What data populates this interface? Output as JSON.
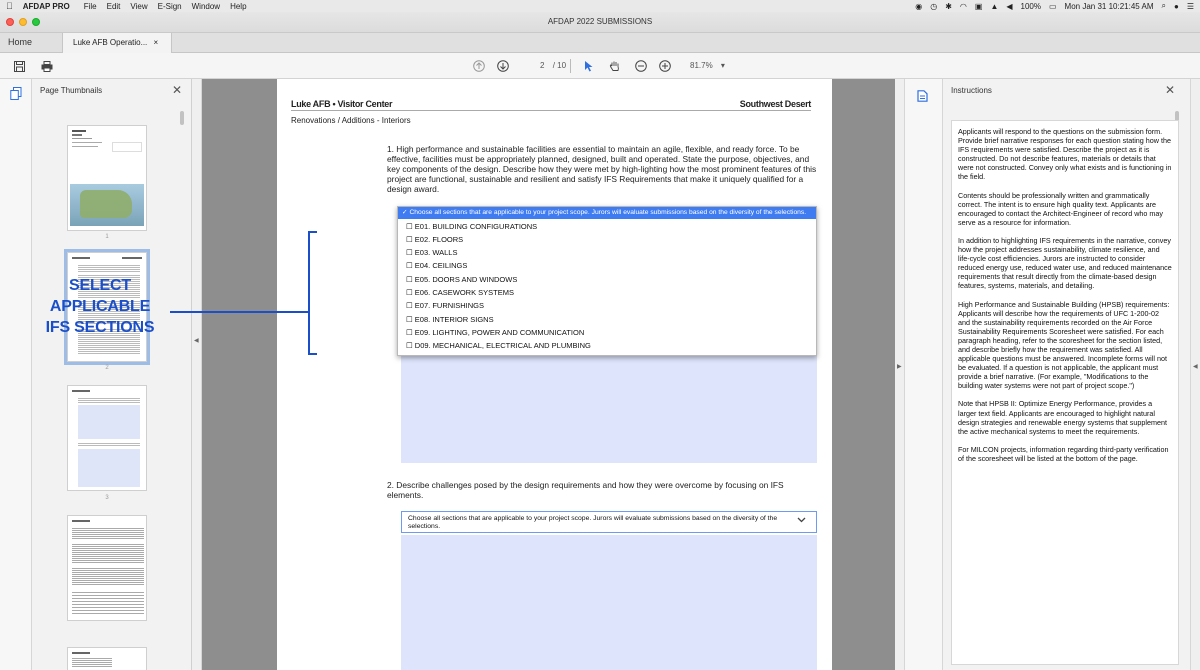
{
  "menubar": {
    "app_name": "AFDAP PRO",
    "items": [
      "File",
      "Edit",
      "View",
      "E-Sign",
      "Window",
      "Help"
    ],
    "battery": "100%",
    "datetime": "Mon Jan 31  10:21:45 AM"
  },
  "window": {
    "title": "AFDAP 2022 SUBMISSIONS"
  },
  "tabs": {
    "home": "Home",
    "document": "Luke AFB Operatio...",
    "close": "×"
  },
  "toolbar": {
    "page_current": "2",
    "page_total": "/ 10",
    "zoom": "81.7%",
    "zoom_caret": "▾"
  },
  "thumbnails": {
    "title": "Page Thumbnails",
    "close": "✕",
    "page_numbers": [
      "1",
      "2",
      "3"
    ]
  },
  "document": {
    "header_left": "Luke AFB • Visitor Center",
    "header_right": "Southwest Desert",
    "subheader": "Renovations / Additions - Interiors",
    "question1": "1. High performance and sustainable facilities are essential to maintain an agile, flexible, and ready force. To be effective, facilities must be appropriately planned, designed, built and operated. State the purpose, objectives, and key components of the design. Describe how they were met by high-lighting how the most prominent features of this project are functional, sustainable and resilient and satisfy IFS Requirements that make it uniquely qualified for a design award.",
    "dropdown_selected": "✓ Choose all sections that are applicable to your project scope. Jurors will evaluate submissions based on the diversity of the selections.",
    "dropdown_options": [
      "☐ E01. BUILDING CONFIGURATIONS",
      "☐ E02. FLOORS",
      "☐ E03. WALLS",
      "☐ E04. CEILINGS",
      "☐ E05. DOORS AND WINDOWS",
      "☐ E06. CASEWORK SYSTEMS",
      "☐ E07. FURNISHINGS",
      "☐ E08. INTERIOR SIGNS",
      "☐ E09. LIGHTING, POWER AND COMMUNICATION",
      "☐ D09. MECHANICAL, ELECTRICAL AND PLUMBING"
    ],
    "question2": "2. Describe challenges posed by the design requirements and how they were overcome by focusing on IFS elements.",
    "select2_text": "Choose all sections that are applicable to your project scope. Jurors will evaluate submissions based on the diversity of the selections."
  },
  "annotation": {
    "line1": "SELECT",
    "line2": "APPLICABLE",
    "line3": "IFS SECTIONS",
    "color": "#1a4fc9"
  },
  "instructions": {
    "title": "Instructions",
    "close": "✕",
    "paragraphs": [
      "Applicants will respond to the questions on the submission form. Provide brief narrative responses for each question stating how the IFS requirements were satisfied. Describe the project as it is constructed. Do not describe features, materials or details that were not constructed. Convey only what exists and is functioning in the field.",
      "Contents should be professionally written and grammatically correct. The intent is to ensure high quality text. Applicants are encouraged to contact the Architect-Engineer of record who may serve as a resource for information.",
      "In addition to highlighting IFS requirements in the narrative, convey how the project addresses sustainability, climate resilience, and life-cycle cost efficiencies. Jurors are instructed to consider reduced energy use, reduced water use, and reduced maintenance requirements that result directly from the climate-based design features, systems, materials, and detailing.",
      "High Performance and Sustainable Building (HPSB) requirements: Applicants will describe how the requirements of UFC 1-200-02 and the sustainability requirements recorded on the Air Force Sustainability Requirements Scoresheet were satisfied. For each paragraph heading, refer to the scoresheet for the section listed, and describe briefly how the requirement was satisfied. All applicable questions must be answered. Incomplete forms will not be evaluated. If a question is not applicable, the applicant must provide a brief narrative. (For example, \"Modifications to the building water systems were not part of project scope.\")",
      "Note that HPSB II: Optimize Energy Performance, provides a larger text field. Applicants are encouraged to highlight natural design strategies and renewable energy systems that supplement the active mechanical systems to meet the requirements.",
      "For MILCON projects, information regarding third-party verification of the scoresheet will be listed at the bottom of the page."
    ]
  },
  "colors": {
    "accent": "#3f7cf2",
    "field": "#dde4fb",
    "gutter": "#8e8e8e"
  }
}
